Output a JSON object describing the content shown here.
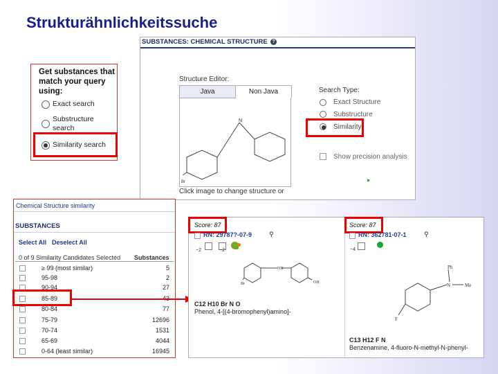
{
  "slide_title": "Strukturähnlichkeitssuche",
  "match_panel": {
    "heading": "Get substances that match your query using:",
    "options": [
      {
        "label": "Exact search",
        "selected": false
      },
      {
        "label": "Substructure search",
        "selected": false
      },
      {
        "label": "Similarity search",
        "selected": true
      }
    ]
  },
  "editor": {
    "header": "SUBSTANCES: CHEMICAL STRUCTURE",
    "structure_editor_label": "Structure Editor:",
    "tabs": [
      "Java",
      "Non Java"
    ],
    "active_tab": "Non Java",
    "search_type_label": "Search Type:",
    "search_types": [
      {
        "label": "Exact Structure",
        "selected": false
      },
      {
        "label": "Substructure",
        "selected": false
      },
      {
        "label": "Similarity",
        "selected": true
      }
    ],
    "show_precision": "Show precision analysis",
    "click_hint": "Click image to change structure or",
    "atom_n": "N",
    "atom_br": "Br"
  },
  "similarity_list": {
    "breadcrumb": "Chemical Structure similarity",
    "section": "SUBSTANCES",
    "select_all": "Select All",
    "deselect_all": "Deselect All",
    "summary": "0 of 9 Similarity Candidates Selected",
    "col_substances": "Substances",
    "rows": [
      {
        "range": "≥ 99 (most similar)",
        "count": "5"
      },
      {
        "range": "95-98",
        "count": "2"
      },
      {
        "range": "90-94",
        "count": "27"
      },
      {
        "range": "85-89",
        "count": "43"
      },
      {
        "range": "80-84",
        "count": "77"
      },
      {
        "range": "75-79",
        "count": "12696"
      },
      {
        "range": "70-74",
        "count": "1531"
      },
      {
        "range": "65-69",
        "count": "4044"
      },
      {
        "range": "0-64 (least similar)",
        "count": "16945"
      }
    ]
  },
  "results": [
    {
      "score": "Score: 87",
      "rn": "RN: 29787?-07-9",
      "formula": "C12 H10 Br N O",
      "name": "Phenol, 4-[(4-bromophenyl)amino]-",
      "count_a": "~2",
      "count_b": "~2",
      "atom_nh": "NH",
      "atom_br": "Br",
      "atom_oh": "OH"
    },
    {
      "score": "Score: 87",
      "rn": "RN: 362781-07-1",
      "formula": "C13 H12 F N",
      "name": "Benzenamine, 4-fluoro-N-methyl-N-phenyl-",
      "count_a": "~4",
      "atom_ph": "Ph",
      "atom_n": "N",
      "atom_me": "Me",
      "atom_f": "F"
    }
  ],
  "colors": {
    "title": "#1c1c8e",
    "highlight": "#ee0000",
    "link": "#1e3c8c"
  }
}
